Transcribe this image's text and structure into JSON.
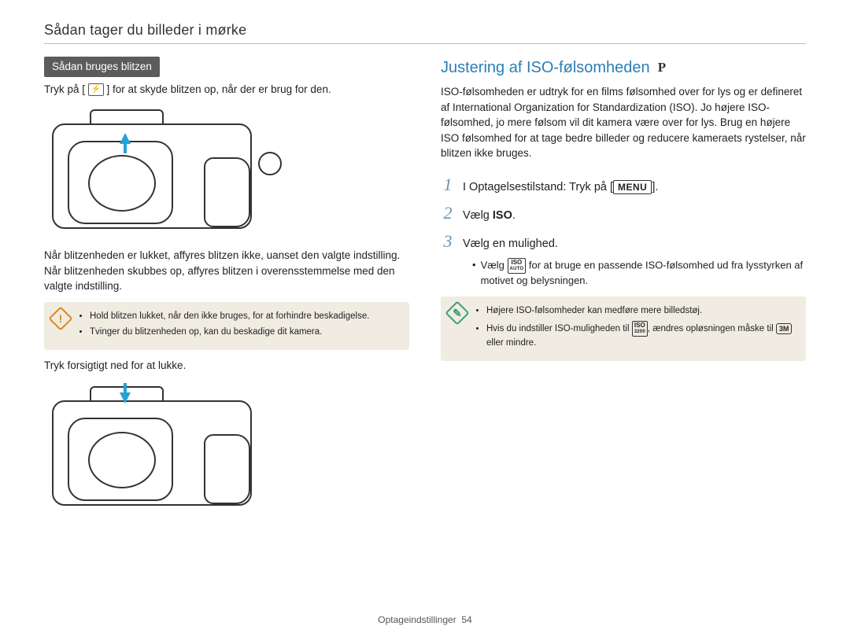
{
  "header": {
    "breadcrumb": "Sådan tager du billeder i mørke"
  },
  "left": {
    "section_pill": "Sådan bruges blitzen",
    "intro_pre": "Tryk på [",
    "intro_icon_name": "flash-icon",
    "intro_icon_glyph": "⚡",
    "intro_post": "] for at skyde blitzen op, når der er brug for den.",
    "para2": "Når blitzenheden er lukket, affyres blitzen ikke, uanset den valgte indstilling. Når blitzenheden skubbes op, affyres blitzen i overensstemmelse med den valgte indstilling.",
    "warning": {
      "badge": "!",
      "items": [
        "Hold blitzen lukket, når den ikke bruges, for at forhindre beskadigelse.",
        "Tvinger du blitzenheden op, kan du beskadige dit kamera."
      ]
    },
    "close_text": "Tryk forsigtigt ned for at lukke."
  },
  "right": {
    "title": "Justering af ISO-følsomheden",
    "mode_badge": "P",
    "intro": "ISO-følsomheden er udtryk for en films følsomhed over for lys og er defineret af International Organization for Standardization (ISO). Jo højere ISO-følsomhed, jo mere følsom vil dit kamera være over for lys. Brug en højere ISO følsomhed for at tage bedre billeder og reducere kameraets rystelser, når blitzen ikke bruges.",
    "steps": [
      {
        "n": "1",
        "pre": "I Optagelsestilstand: Tryk på [",
        "chip": "MENU",
        "post": "]."
      },
      {
        "n": "2",
        "pre": "Vælg ",
        "bold": "ISO",
        "post": "."
      },
      {
        "n": "3",
        "pre": "Vælg en mulighed.",
        "post": ""
      }
    ],
    "sub": {
      "pre": "Vælg ",
      "iso_chip_top": "ISO",
      "iso_chip_sub": "AUTO",
      "post": " for at bruge en passende ISO-følsomhed ud fra lysstyrken af motivet og belysningen."
    },
    "info": {
      "badge": "✎",
      "items": [
        "Højere ISO-følsomheder kan medføre mere billedstøj.",
        {
          "pre": "Hvis du indstiller ISO-muligheden til ",
          "chip_top": "ISO",
          "chip_sub": "3200",
          "mid": ", ændres opløsningen måske til ",
          "res_chip": "3M",
          "post": " eller mindre."
        }
      ]
    }
  },
  "footer": {
    "section": "Optageindstillinger",
    "page": "54"
  }
}
